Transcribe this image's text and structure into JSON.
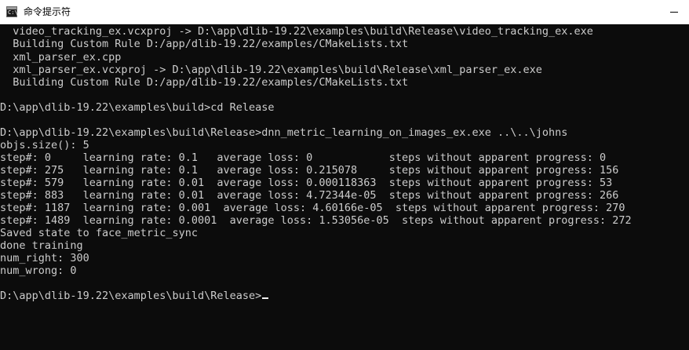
{
  "window": {
    "title": "命令提示符",
    "icon": "cmd-icon",
    "icon_glyph": "C:\\"
  },
  "terminal": {
    "lines": [
      "  video_tracking_ex.vcxproj -> D:\\app\\dlib-19.22\\examples\\build\\Release\\video_tracking_ex.exe",
      "  Building Custom Rule D:/app/dlib-19.22/examples/CMakeLists.txt",
      "  xml_parser_ex.cpp",
      "  xml_parser_ex.vcxproj -> D:\\app\\dlib-19.22\\examples\\build\\Release\\xml_parser_ex.exe",
      "  Building Custom Rule D:/app/dlib-19.22/examples/CMakeLists.txt",
      "",
      "D:\\app\\dlib-19.22\\examples\\build>cd Release",
      "",
      "D:\\app\\dlib-19.22\\examples\\build\\Release>dnn_metric_learning_on_images_ex.exe ..\\..\\johns",
      "objs.size(): 5",
      "step#: 0     learning rate: 0.1   average loss: 0            steps without apparent progress: 0",
      "step#: 275   learning rate: 0.1   average loss: 0.215078     steps without apparent progress: 156",
      "step#: 579   learning rate: 0.01  average loss: 0.000118363  steps without apparent progress: 53",
      "step#: 883   learning rate: 0.01  average loss: 4.72344e-05  steps without apparent progress: 266",
      "step#: 1187  learning rate: 0.001  average loss: 4.60166e-05  steps without apparent progress: 270",
      "step#: 1489  learning rate: 0.0001  average loss: 1.53056e-05  steps without apparent progress: 272",
      "Saved state to face_metric_sync",
      "done training",
      "num_right: 300",
      "num_wrong: 0",
      "",
      "D:\\app\\dlib-19.22\\examples\\build\\Release>"
    ]
  },
  "colors": {
    "background": "#0c0c0c",
    "text": "#cccccc",
    "titlebar": "#ffffff",
    "cursor": "#f2f2f2"
  }
}
